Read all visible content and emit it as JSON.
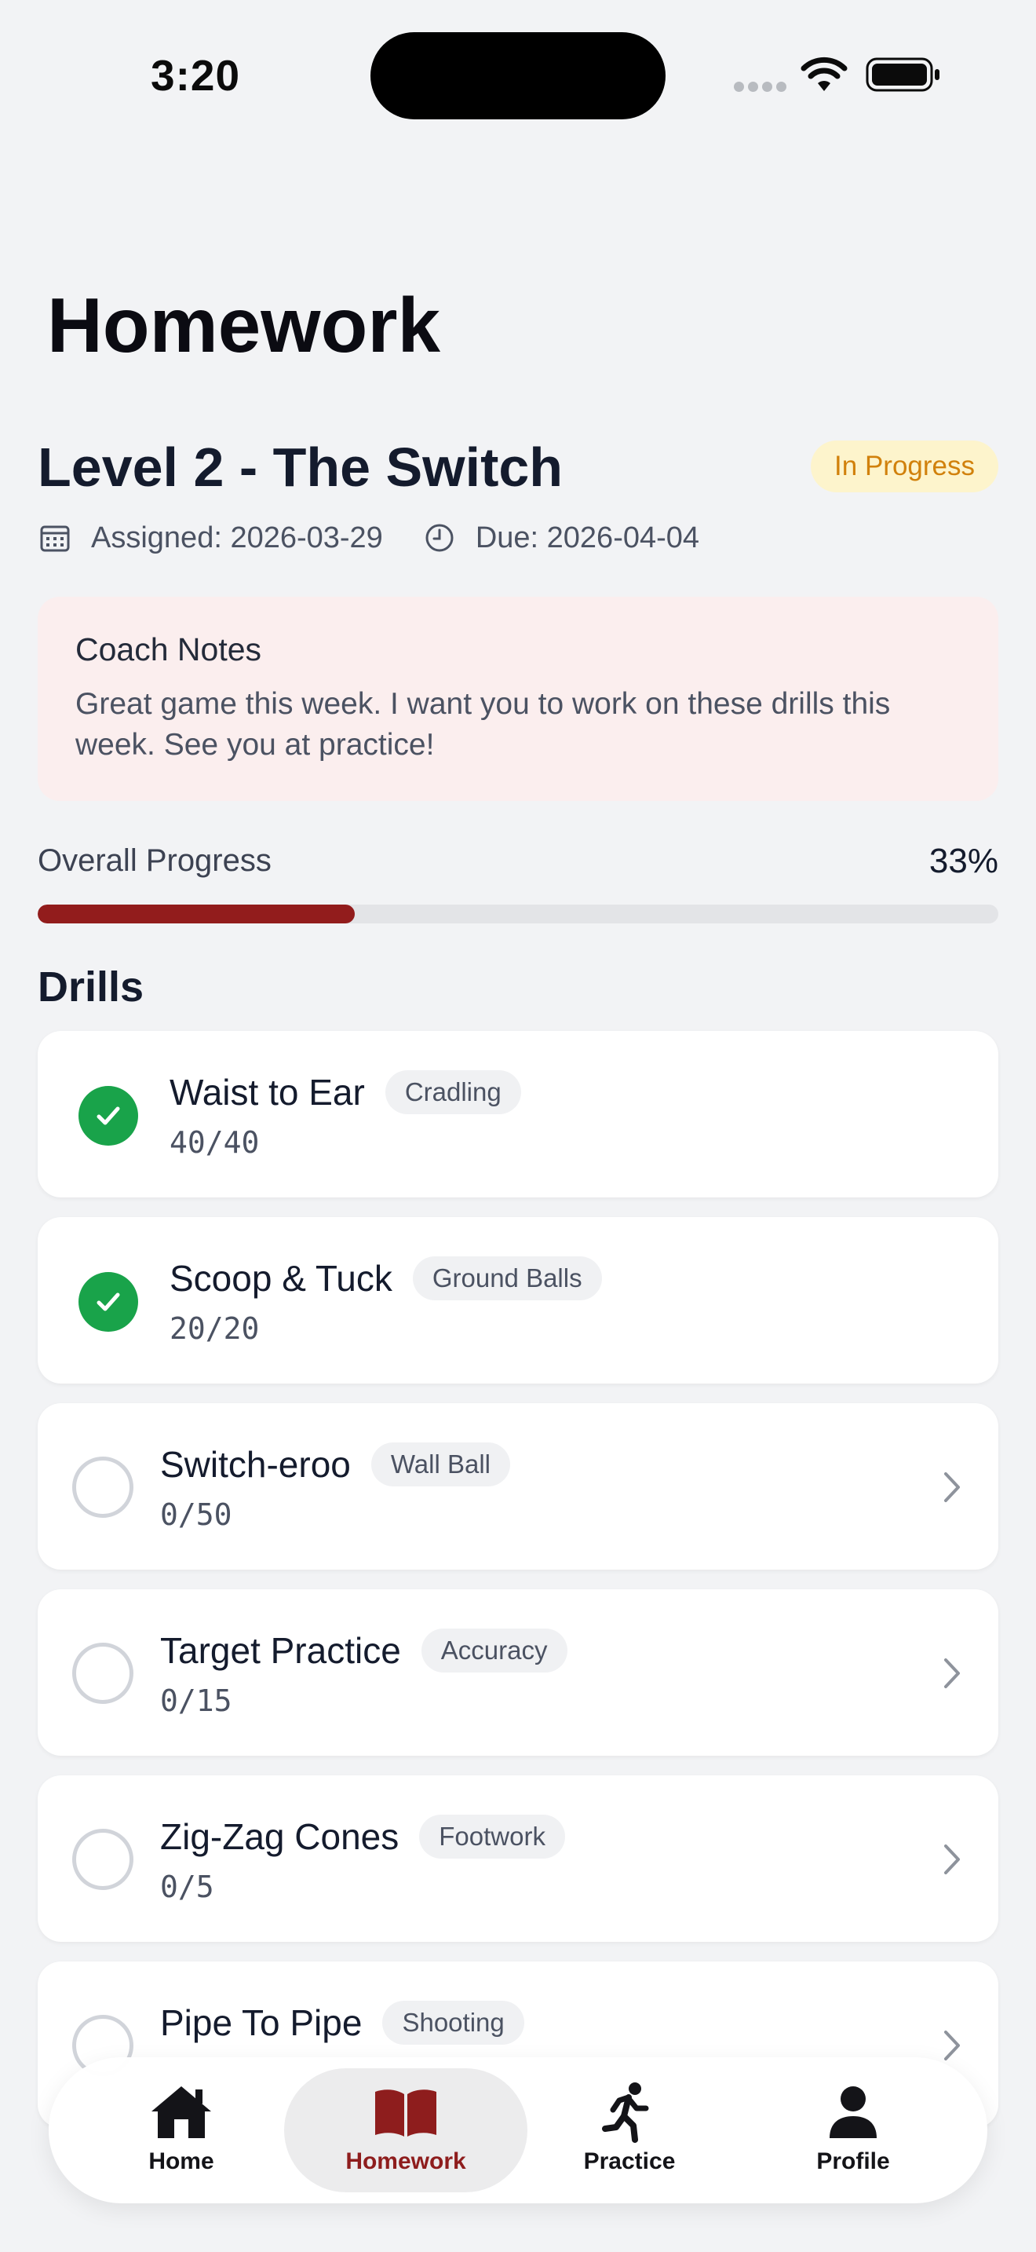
{
  "status_bar": {
    "time": "3:20"
  },
  "page": {
    "title": "Homework"
  },
  "homework": {
    "title": "Level 2 - The Switch",
    "status": "In Progress",
    "assigned": "Assigned: 2026-03-29",
    "due": "Due: 2026-04-04"
  },
  "coach_notes": {
    "title": "Coach Notes",
    "body": "Great game this week.  I want you to work on these drills this week.  See you at practice!"
  },
  "progress": {
    "label": "Overall Progress",
    "value_text": "33%",
    "fraction": 0.33
  },
  "drills_heading": "Drills",
  "drills": [
    {
      "name": "Waist to Ear",
      "tag": "Cradling",
      "count": "40/40",
      "completed": true
    },
    {
      "name": "Scoop & Tuck",
      "tag": "Ground Balls",
      "count": "20/20",
      "completed": true
    },
    {
      "name": "Switch-eroo",
      "tag": "Wall Ball",
      "count": "0/50",
      "completed": false
    },
    {
      "name": "Target Practice",
      "tag": "Accuracy",
      "count": "0/15",
      "completed": false
    },
    {
      "name": "Zig-Zag Cones",
      "tag": "Footwork",
      "count": "0/5",
      "completed": false
    },
    {
      "name": "Pipe To Pipe",
      "tag": "Shooting",
      "count": "",
      "completed": false
    }
  ],
  "tabs": [
    {
      "label": "Home",
      "icon": "home-icon"
    },
    {
      "label": "Homework",
      "icon": "book-icon",
      "active": true
    },
    {
      "label": "Practice",
      "icon": "running-person-icon"
    },
    {
      "label": "Profile",
      "icon": "person-icon"
    }
  ],
  "colors": {
    "accent": "#921c1c",
    "success": "#19a34a",
    "badge_bg": "#fdf4cc",
    "badge_text": "#d1810c",
    "notes_bg": "#fbeeee"
  }
}
